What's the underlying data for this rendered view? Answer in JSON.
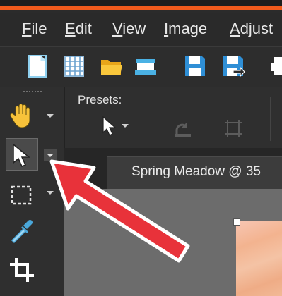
{
  "menu": {
    "items": [
      "File",
      "Edit",
      "View",
      "Image",
      "Adjust"
    ],
    "mnemonics": [
      "F",
      "E",
      "V",
      "I",
      "A"
    ]
  },
  "toolbar": {
    "buttons": [
      "new-file-icon",
      "grid-icon",
      "open-folder-icon",
      "scanner-icon",
      "save-icon",
      "save-as-icon",
      "print-icon"
    ]
  },
  "tools_panel": {
    "tools": [
      "pan-hand-tool",
      "pick-arrow-tool",
      "selection-rectangle-tool",
      "dropper-tool",
      "crop-tool"
    ],
    "selected": "pick-arrow-tool"
  },
  "options": {
    "presets_label": "Presets:"
  },
  "document": {
    "tab_title": "Spring Meadow @  35"
  },
  "colors": {
    "accent_bar": "#f05a1c",
    "annotation_arrow": "#e8323a"
  }
}
